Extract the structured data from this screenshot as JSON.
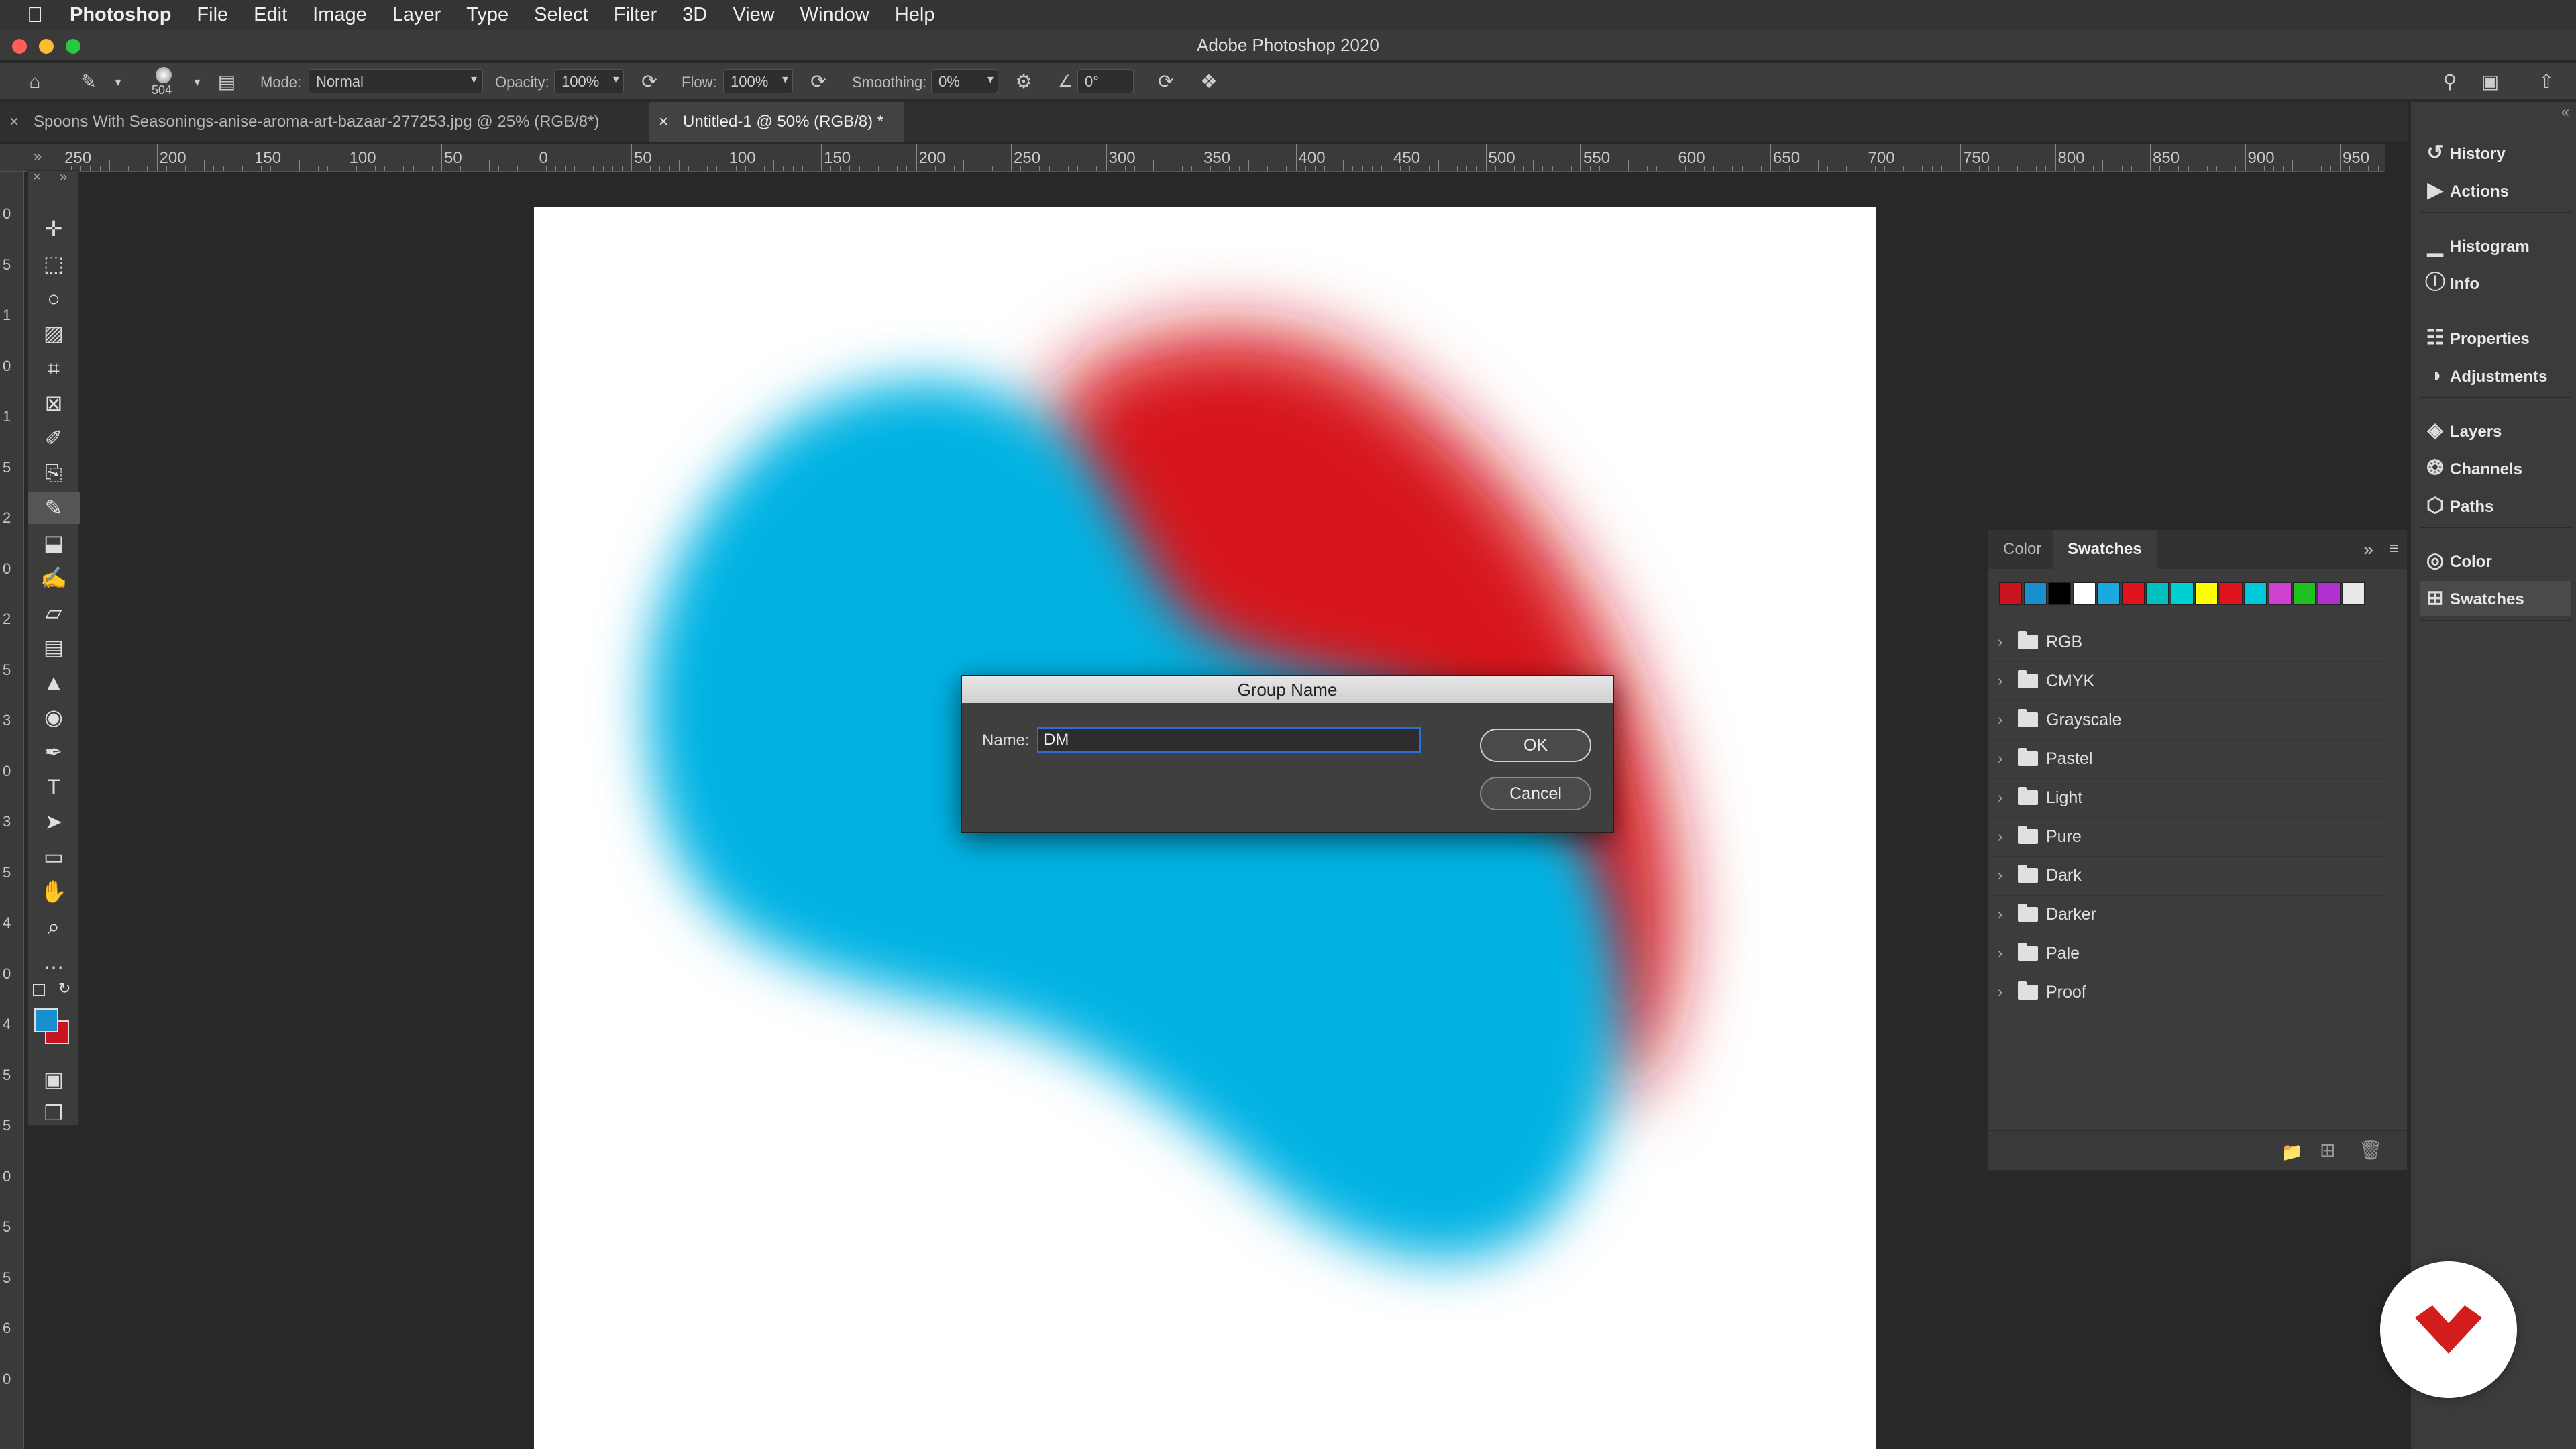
{
  "menubar": {
    "items": [
      "Photoshop",
      "File",
      "Edit",
      "Image",
      "Layer",
      "Type",
      "Select",
      "Filter",
      "3D",
      "View",
      "Window",
      "Help"
    ]
  },
  "window": {
    "title": "Adobe Photoshop 2020"
  },
  "options": {
    "brush_size": "504",
    "mode_label": "Mode:",
    "mode_value": "Normal",
    "opacity_label": "Opacity:",
    "opacity_value": "100%",
    "flow_label": "Flow:",
    "flow_value": "100%",
    "smoothing_label": "Smoothing:",
    "smoothing_value": "0%",
    "angle_value": "0°"
  },
  "tabs": [
    {
      "label": "Spoons With Seasonings-anise-aroma-art-bazaar-277253.jpg @ 25% (RGB/8*)",
      "active": false
    },
    {
      "label": "Untitled-1 @ 50% (RGB/8) *",
      "active": true
    }
  ],
  "ruler": {
    "h_ticks": [
      "250",
      "200",
      "150",
      "100",
      "50",
      "0",
      "50",
      "100",
      "150",
      "200",
      "250",
      "300",
      "350",
      "400",
      "450",
      "500",
      "550",
      "600",
      "650",
      "700",
      "750",
      "800",
      "850",
      "900",
      "950"
    ],
    "v_ticks": [
      "0",
      "5",
      "1",
      "0",
      "1",
      "5",
      "2",
      "0",
      "2",
      "5",
      "3",
      "0",
      "3",
      "5",
      "4",
      "0",
      "4",
      "5",
      "5",
      "0",
      "5",
      "5",
      "6",
      "0"
    ]
  },
  "tools": [
    "move-icon",
    "marquee-icon",
    "lasso-icon",
    "object-select-icon",
    "crop-icon",
    "frame-icon",
    "eyedropper-icon",
    "healing-icon",
    "brush-icon",
    "stamp-icon",
    "history-brush-icon",
    "eraser-icon",
    "gradient-icon",
    "blur-icon",
    "dodge-icon",
    "pen-icon",
    "type-icon",
    "path-select-icon",
    "rectangle-icon",
    "hand-icon",
    "zoom-icon",
    "more-icon"
  ],
  "colors": {
    "foreground": "#1a8fd0",
    "background": "#c8141e",
    "blue_blob": "#00b2e3",
    "red_blob": "#d7161b"
  },
  "dock": {
    "groups": [
      [
        {
          "icon": "history-icon",
          "label": "History"
        },
        {
          "icon": "actions-icon",
          "label": "Actions"
        }
      ],
      [
        {
          "icon": "histogram-icon",
          "label": "Histogram"
        },
        {
          "icon": "info-icon",
          "label": "Info"
        }
      ],
      [
        {
          "icon": "properties-icon",
          "label": "Properties"
        },
        {
          "icon": "adjustments-icon",
          "label": "Adjustments"
        }
      ],
      [
        {
          "icon": "layers-icon",
          "label": "Layers"
        },
        {
          "icon": "channels-icon",
          "label": "Channels"
        },
        {
          "icon": "paths-icon",
          "label": "Paths"
        }
      ],
      [
        {
          "icon": "color-icon",
          "label": "Color"
        },
        {
          "icon": "swatches-icon",
          "label": "Swatches",
          "selected": true
        }
      ]
    ]
  },
  "swatches_panel": {
    "tabs": [
      "Color",
      "Swatches"
    ],
    "active_tab": "Swatches",
    "recent": [
      "#c8141e",
      "#1a8fd0",
      "#000000",
      "#ffffff",
      "#1aa9e0",
      "#e0141e",
      "#00c0c0",
      "#00d0d0",
      "#ffff00",
      "#e0141e",
      "#00c8d8",
      "#d040d0",
      "#20c020",
      "#b030d0",
      "#e8e8e8"
    ],
    "groups": [
      "RGB",
      "CMYK",
      "Grayscale",
      "Pastel",
      "Light",
      "Pure",
      "Dark",
      "Darker",
      "Pale",
      "Proof"
    ]
  },
  "dialog": {
    "title": "Group Name",
    "name_label": "Name:",
    "name_value": "DM",
    "ok_label": "OK",
    "cancel_label": "Cancel"
  }
}
